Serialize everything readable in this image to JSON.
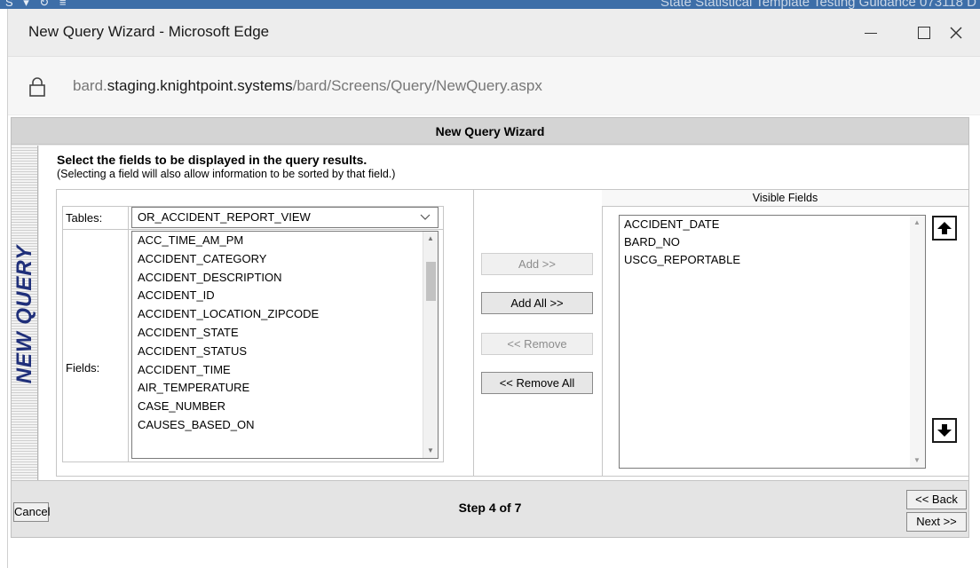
{
  "background": {
    "left_glyphs": "S ▾ ↻  ≡",
    "right_text": "State Statistical Template Testing Guidance 073118 D"
  },
  "window": {
    "title": "New Query Wizard - Microsoft Edge",
    "controls": {
      "minimize": "minimize-icon",
      "maximize": "maximize-icon",
      "close": "×"
    }
  },
  "address": {
    "prefix": "bard.",
    "domain": "staging.knightpoint.systems",
    "path": "/bard/Screens/Query/NewQuery.aspx",
    "icon": "lock-icon"
  },
  "wizard": {
    "title": "New Query Wizard",
    "side_banner": "NEW QUERY",
    "instruction_title": "Select the fields to be displayed in the query results.",
    "instruction_sub": "(Selecting a field will also allow information to be sorted by that field.)",
    "tables_label": "Tables:",
    "fields_label": "Fields:",
    "selected_table": "OR_ACCIDENT_REPORT_VIEW",
    "fields": [
      "ACC_TIME_AM_PM",
      "ACCIDENT_CATEGORY",
      "ACCIDENT_DESCRIPTION",
      "ACCIDENT_ID",
      "ACCIDENT_LOCATION_ZIPCODE",
      "ACCIDENT_STATE",
      "ACCIDENT_STATUS",
      "ACCIDENT_TIME",
      "AIR_TEMPERATURE",
      "CASE_NUMBER",
      "CAUSES_BASED_ON"
    ],
    "buttons": {
      "add": "Add >>",
      "add_all": "Add All >>",
      "remove": "<< Remove",
      "remove_all": "<< Remove All"
    },
    "visible_fields_header": "Visible Fields",
    "visible_fields": [
      "ACCIDENT_DATE",
      "BARD_NO",
      "USCG_REPORTABLE"
    ],
    "move_up_icon": "arrow-up-icon",
    "move_down_icon": "arrow-down-icon"
  },
  "footer": {
    "cancel": "Cancel",
    "step": "Step 4 of 7",
    "back": "<< Back",
    "next": "Next >>"
  }
}
